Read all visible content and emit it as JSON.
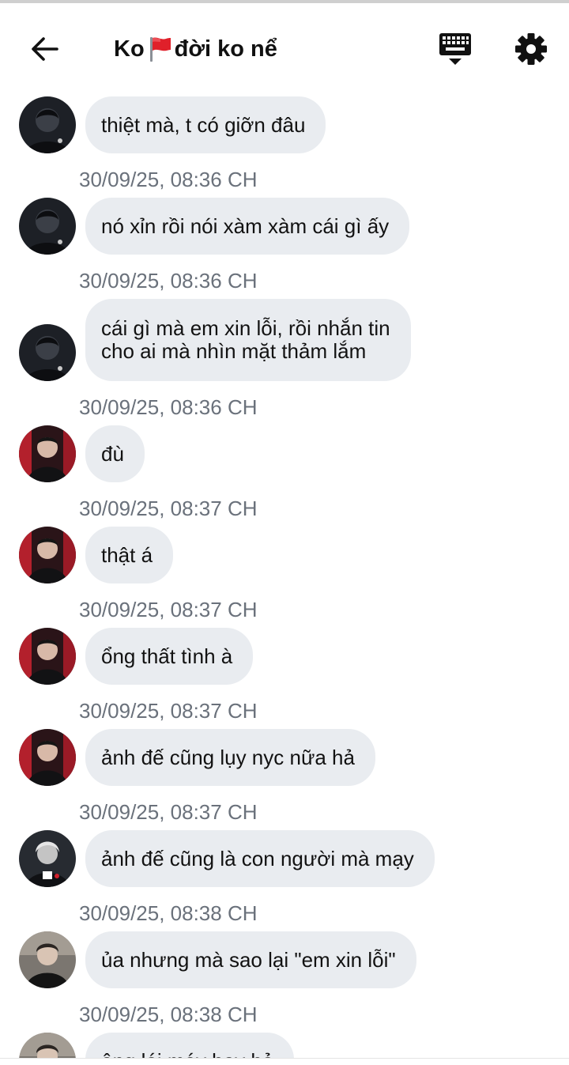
{
  "header": {
    "title_before_flag": "Ko",
    "title_after_flag": "đời ko nể",
    "back_icon": "arrow-left-icon",
    "keyboard_icon": "keyboard-icon",
    "settings_icon": "gear-icon"
  },
  "colors": {
    "bubble_bg": "#e9ecf0",
    "timestamp": "#6a717b",
    "flag_red": "#e0202a"
  },
  "messages": [
    {
      "text": "thiệt mà, t có giỡn đâu",
      "time": "30/09/25, 08:36 CH"
    },
    {
      "text": "nó xỉn rồi nói xàm xàm cái gì ấy",
      "time": "30/09/25, 08:36 CH"
    },
    {
      "text": "cái gì mà em xin lỗi, rồi nhắn tin\ncho ai mà nhìn mặt thảm lắm",
      "time": "30/09/25, 08:36 CH"
    },
    {
      "text": "đù",
      "time": "30/09/25, 08:37 CH"
    },
    {
      "text": "thật á",
      "time": "30/09/25, 08:37 CH"
    },
    {
      "text": "ổng thất tình à",
      "time": "30/09/25, 08:37 CH"
    },
    {
      "text": "ảnh đế cũng lụy nyc nữa hả",
      "time": "30/09/25, 08:37 CH"
    },
    {
      "text": "ảnh đế cũng là con người mà mạy",
      "time": "30/09/25, 08:38 CH"
    },
    {
      "text": "ủa nhưng mà sao lại \"em xin lỗi\"",
      "time": "30/09/25, 08:38 CH"
    },
    {
      "text": "ông lói máy bay hả",
      "time": ""
    }
  ]
}
